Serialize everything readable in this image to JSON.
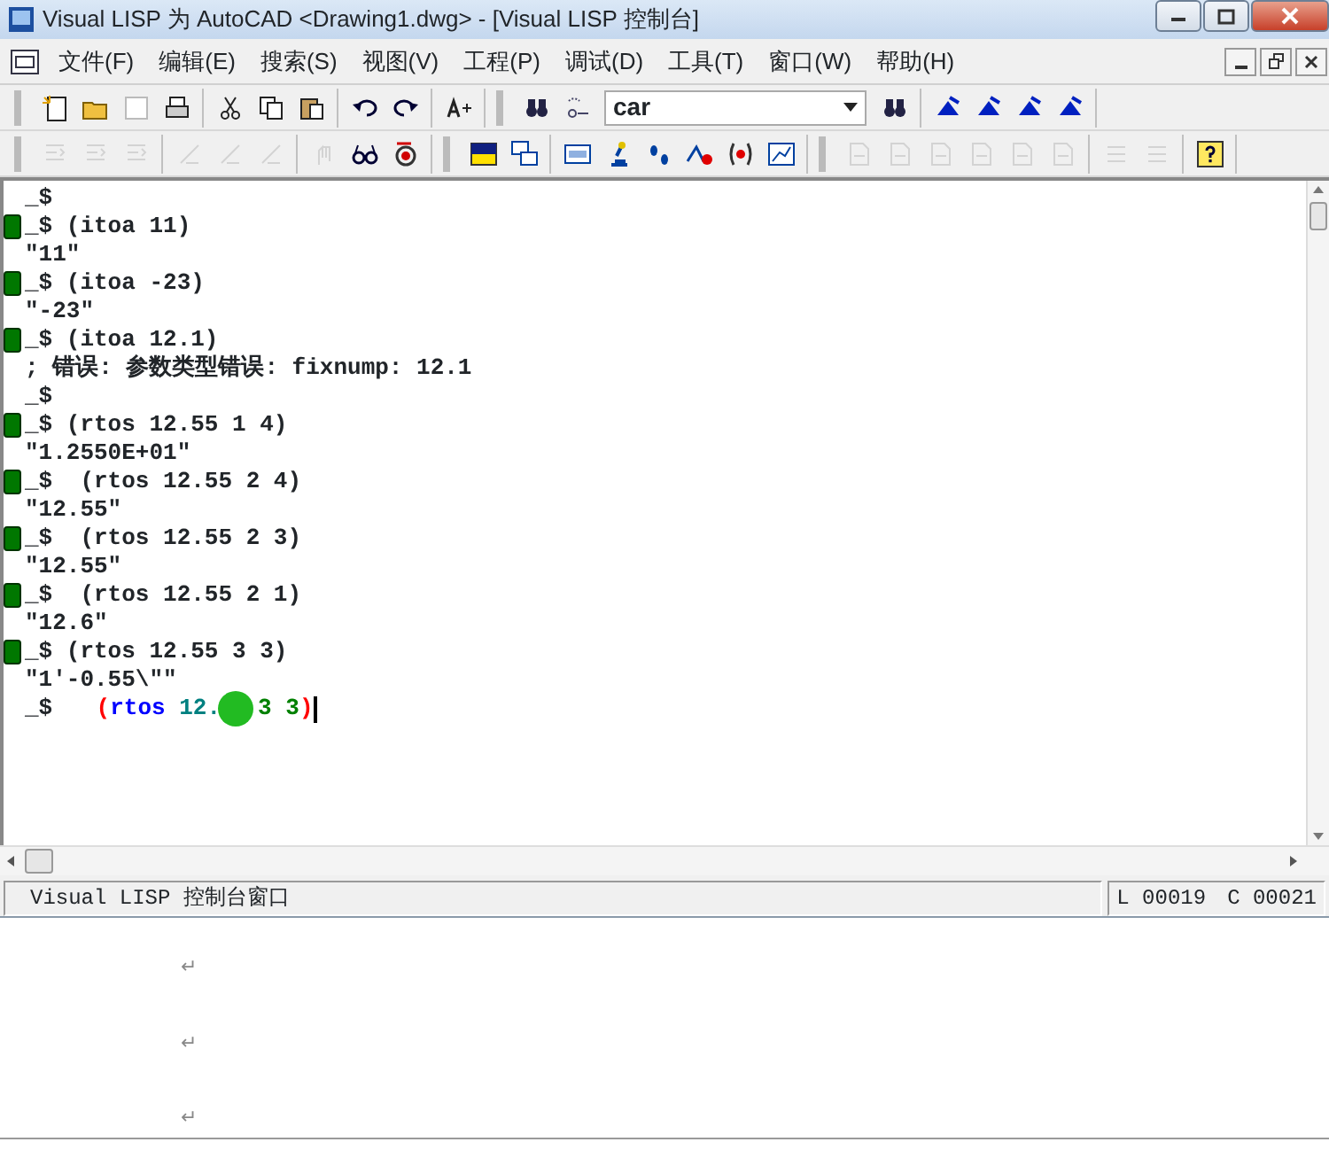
{
  "window": {
    "title": "Visual LISP 为 AutoCAD <Drawing1.dwg> - [Visual LISP 控制台]"
  },
  "menu": [
    "文件(F)",
    "编辑(E)",
    "搜索(S)",
    "视图(V)",
    "工程(P)",
    "调试(D)",
    "工具(T)",
    "窗口(W)",
    "帮助(H)"
  ],
  "toolbar_rows": [
    [
      {
        "grip": true,
        "items": [
          {
            "kind": "new",
            "disabled": false
          },
          {
            "kind": "open",
            "disabled": false
          },
          {
            "kind": "blank",
            "disabled": false
          },
          {
            "kind": "print",
            "disabled": false
          }
        ]
      },
      {
        "grip": false,
        "items": [
          {
            "kind": "cut",
            "disabled": false
          },
          {
            "kind": "copy",
            "disabled": false
          },
          {
            "kind": "paste",
            "disabled": false
          }
        ]
      },
      {
        "grip": false,
        "items": [
          {
            "kind": "undo",
            "disabled": false
          },
          {
            "kind": "redo",
            "disabled": false
          }
        ]
      },
      {
        "grip": false,
        "items": [
          {
            "kind": "format",
            "disabled": false
          }
        ]
      },
      {
        "grip": true,
        "items": [
          {
            "kind": "find",
            "disabled": false
          },
          {
            "kind": "replace",
            "disabled": false
          },
          {
            "kind": "combo"
          },
          {
            "kind": "find",
            "disabled": false
          }
        ]
      },
      {
        "grip": false,
        "items": [
          {
            "kind": "bookmark",
            "disabled": false
          },
          {
            "kind": "bookmark",
            "disabled": false
          },
          {
            "kind": "bookmark",
            "disabled": false
          },
          {
            "kind": "bookmark",
            "disabled": false
          }
        ]
      }
    ],
    [
      {
        "grip": true,
        "items": [
          {
            "kind": "indent",
            "disabled": true
          },
          {
            "kind": "indent",
            "disabled": true
          },
          {
            "kind": "indent",
            "disabled": true
          }
        ]
      },
      {
        "grip": false,
        "items": [
          {
            "kind": "slash",
            "disabled": true
          },
          {
            "kind": "slash",
            "disabled": true
          },
          {
            "kind": "slash",
            "disabled": true
          }
        ]
      },
      {
        "grip": false,
        "items": [
          {
            "kind": "hand",
            "disabled": true
          },
          {
            "kind": "glasses",
            "disabled": false
          },
          {
            "kind": "record",
            "disabled": false
          }
        ]
      },
      {
        "grip": true,
        "items": [
          {
            "kind": "image",
            "disabled": false
          },
          {
            "kind": "windows",
            "disabled": false
          }
        ]
      },
      {
        "grip": false,
        "items": [
          {
            "kind": "label",
            "disabled": false
          },
          {
            "kind": "microscope",
            "disabled": false
          },
          {
            "kind": "steps",
            "disabled": false
          },
          {
            "kind": "breakpoint",
            "disabled": false
          },
          {
            "kind": "parens",
            "disabled": false
          },
          {
            "kind": "chart",
            "disabled": false
          }
        ]
      },
      {
        "grip": true,
        "items": [
          {
            "kind": "page",
            "disabled": true
          },
          {
            "kind": "page",
            "disabled": true
          },
          {
            "kind": "page",
            "disabled": true
          },
          {
            "kind": "page",
            "disabled": true
          },
          {
            "kind": "page",
            "disabled": true
          },
          {
            "kind": "page",
            "disabled": true
          }
        ]
      },
      {
        "grip": false,
        "items": [
          {
            "kind": "list",
            "disabled": true
          },
          {
            "kind": "list",
            "disabled": true
          }
        ]
      },
      {
        "grip": false,
        "items": [
          {
            "kind": "help",
            "disabled": false
          }
        ]
      }
    ]
  ],
  "search": {
    "value": "car"
  },
  "console": [
    {
      "text": "_$",
      "marker": false
    },
    {
      "text": "_$ (itoa 11)",
      "marker": true
    },
    {
      "text": "\"11\"",
      "marker": false
    },
    {
      "text": "_$ (itoa -23)",
      "marker": true
    },
    {
      "text": "\"-23\"",
      "marker": false
    },
    {
      "text": "_$ (itoa 12.1)",
      "marker": true
    },
    {
      "text": "; 错误: 参数类型错误: fixnump: 12.1",
      "marker": false
    },
    {
      "text": "_$",
      "marker": false
    },
    {
      "text": "_$ (rtos 12.55 1 4)",
      "marker": true
    },
    {
      "text": "\"1.2550E+01\"",
      "marker": false
    },
    {
      "text": "_$  (rtos 12.55 2 4)",
      "marker": true
    },
    {
      "text": "\"12.55\"",
      "marker": false
    },
    {
      "text": "_$  (rtos 12.55 2 3)",
      "marker": true
    },
    {
      "text": "\"12.55\"",
      "marker": false
    },
    {
      "text": "_$  (rtos 12.55 2 1)",
      "marker": true
    },
    {
      "text": "\"12.6\"",
      "marker": false
    },
    {
      "text": "_$ (rtos 12.55 3 3)",
      "marker": true
    },
    {
      "text": "\"1'-0.55\\\"\"",
      "marker": false
    }
  ],
  "input": {
    "prompt": "_$",
    "tokens": [
      {
        "text": "(",
        "color": "#ff0000"
      },
      {
        "text": "rtos",
        "color": "#0000ff"
      },
      {
        "text": "12.",
        "color": "#008080"
      },
      {
        "kind": "highlight"
      },
      {
        "text": "3",
        "color": "#008000"
      },
      {
        "text": "3",
        "color": "#008000"
      },
      {
        "text": ")",
        "color": "#ff0000"
      }
    ]
  },
  "status_bar": {
    "message": "Visual LISP 控制台窗口",
    "line": "L 00019",
    "column": "C 00021"
  },
  "document": {
    "marks": [
      "↵",
      "↵",
      "↵"
    ]
  }
}
